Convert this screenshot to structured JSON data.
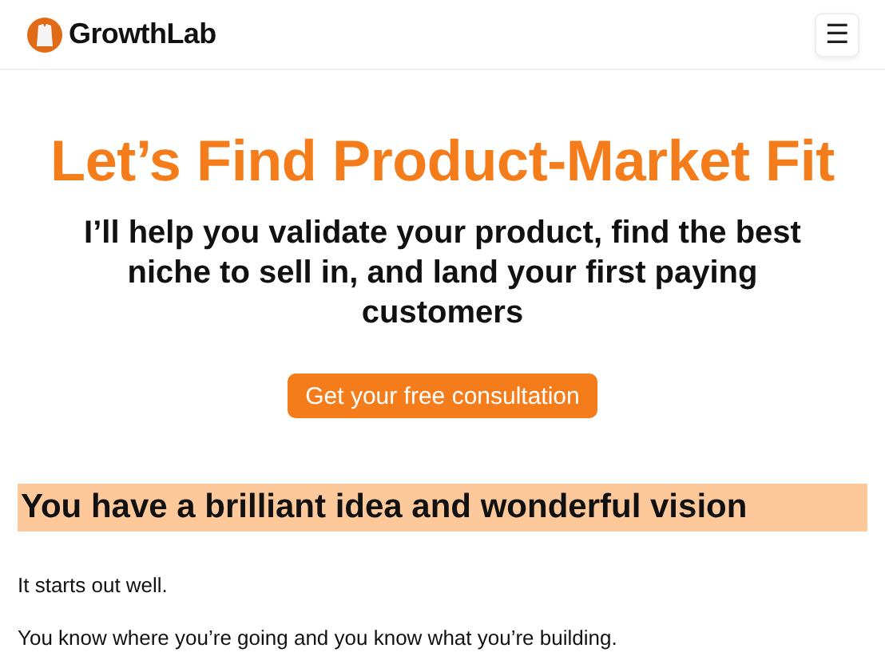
{
  "header": {
    "brand": "GrowthLab",
    "menu_button": "☰"
  },
  "hero": {
    "title": "Let’s Find Product-Market Fit",
    "subtitle": "I’ll help you validate your product, find the best niche to sell in, and land your first paying customers",
    "cta": "Get your free consultation"
  },
  "section": {
    "heading": "You have a brilliant idea and wonderful vision",
    "paragraphs": [
      "It starts out well.",
      "You know where you’re going and you know what you’re building."
    ]
  }
}
